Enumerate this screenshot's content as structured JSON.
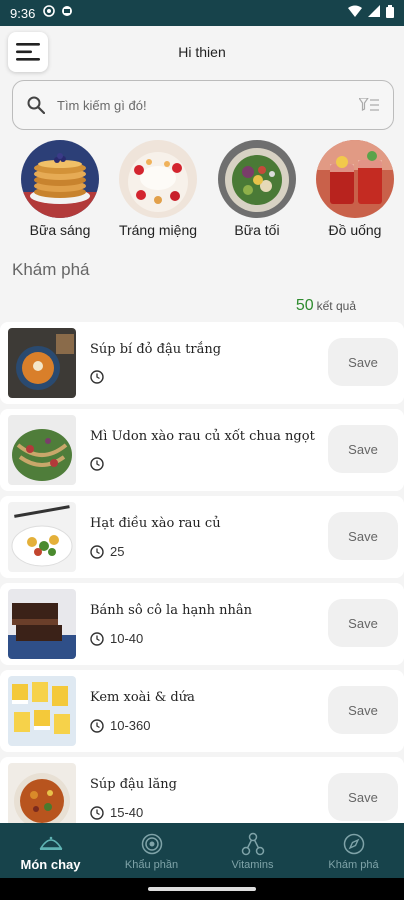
{
  "status": {
    "time": "9:36"
  },
  "header": {
    "greeting": "Hi thien"
  },
  "search": {
    "placeholder": "Tìm kiếm gì đó!"
  },
  "categories": [
    {
      "label": "Bữa sáng",
      "image": "pancakes"
    },
    {
      "label": "Tráng miệng",
      "image": "dessert"
    },
    {
      "label": "Bữa tối",
      "image": "salad"
    },
    {
      "label": "Đồ uống",
      "image": "drinks"
    }
  ],
  "section": {
    "title": "Khám phá"
  },
  "results": {
    "count": "50",
    "suffix": "kết quả"
  },
  "recipes": [
    {
      "title": "Súp bí đỏ đậu trắng",
      "time": "",
      "save": "Save"
    },
    {
      "title": "Mì Udon xào rau củ xốt chua ngọt",
      "time": "",
      "save": "Save"
    },
    {
      "title": "Hạt điều xào rau củ",
      "time": "25",
      "save": "Save"
    },
    {
      "title": "Bánh sô cô la hạnh nhân",
      "time": "10-40",
      "save": "Save"
    },
    {
      "title": "Kem xoài & dứa",
      "time": "10-360",
      "save": "Save"
    },
    {
      "title": "Súp đậu lăng",
      "time": "15-40",
      "save": "Save"
    }
  ],
  "nav": [
    {
      "label": "Món chay",
      "icon": "dish-icon",
      "active": true
    },
    {
      "label": "Khẩu phần",
      "icon": "target-icon",
      "active": false
    },
    {
      "label": "Vitamins",
      "icon": "molecule-icon",
      "active": false
    },
    {
      "label": "Khám phá",
      "icon": "compass-icon",
      "active": false
    }
  ],
  "colors": {
    "primary": "#17434b",
    "accent": "#2e8b2e"
  }
}
